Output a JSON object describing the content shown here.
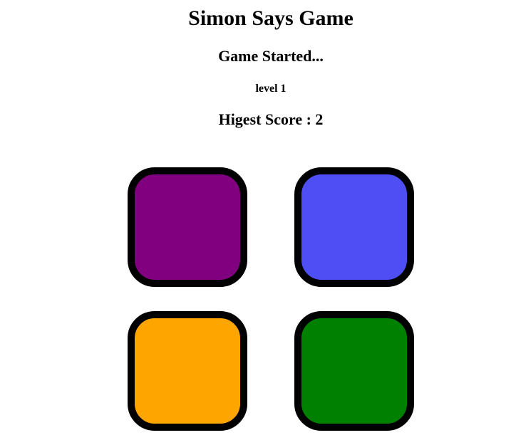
{
  "game": {
    "title": "Simon Says Game",
    "status": "Game Started...",
    "level": "level 1",
    "highest_score": "Higest Score : 2"
  },
  "buttons": [
    {
      "name": "purple",
      "color": "#800080"
    },
    {
      "name": "blue",
      "color": "#4d4ff5"
    },
    {
      "name": "orange",
      "color": "#ffa500"
    },
    {
      "name": "green",
      "color": "#008000"
    }
  ]
}
